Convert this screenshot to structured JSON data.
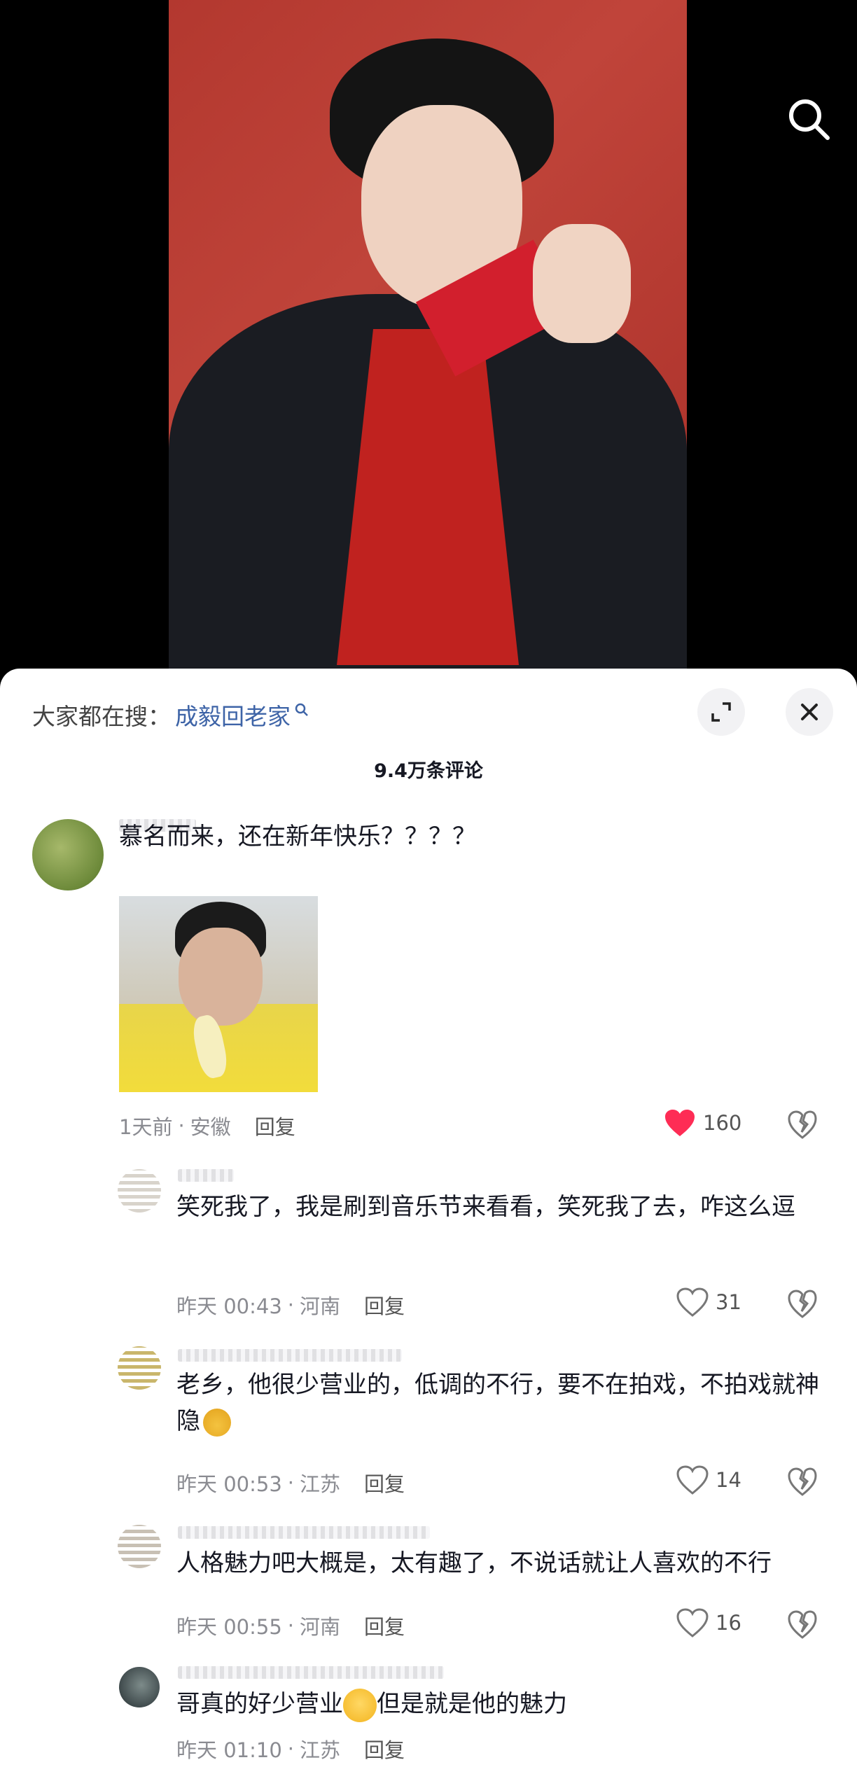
{
  "search_bar": {
    "prefix": "大家都在搜：",
    "keyword": "成毅回老家"
  },
  "comment_count": "9.4万条评论",
  "comments": [
    {
      "text": "慕名而来，还在新年快乐？？？？",
      "time": "1天前",
      "location": "安徽",
      "reply": "回复",
      "likes": "160",
      "liked": true
    },
    {
      "text": "笑死我了，我是刷到音乐节来看看，笑死我了去，咋这么逗",
      "time": "昨天 00:43",
      "location": "河南",
      "reply": "回复",
      "likes": "31",
      "liked": false
    },
    {
      "text": "老乡，他很少营业的，低调的不行，要不在拍戏，不拍戏就神隐",
      "time": "昨天 00:53",
      "location": "江苏",
      "reply": "回复",
      "likes": "14",
      "liked": false
    },
    {
      "text": "人格魅力吧大概是，太有趣了，不说话就让人喜欢的不行",
      "time": "昨天 00:55",
      "location": "河南",
      "reply": "回复",
      "likes": "16",
      "liked": false
    },
    {
      "text_a": "哥真的好少营业",
      "text_b": "但是就是他的魅力",
      "time": "昨天 01:10",
      "location": "江苏",
      "reply": "回复"
    }
  ],
  "colors": {
    "liked": "#fe2c55",
    "keyword": "#3e64a7",
    "meta": "#8a8b91"
  },
  "icons": [
    "search-icon",
    "expand-icon",
    "close-icon",
    "heart-icon",
    "broken-heart-icon",
    "magnifier-small-icon",
    "finger-heart-emoji",
    "pleading-emoji"
  ]
}
